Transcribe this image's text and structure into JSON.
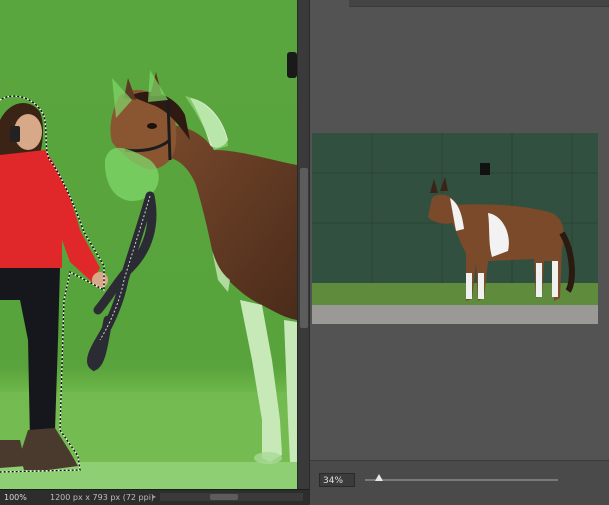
{
  "canvas": {
    "zoom_label": "100%",
    "document_info": "1200 px x 793 px (72 ppi)",
    "status_arrow_icon": "chevron-right-icon"
  },
  "preview_panel": {
    "zoom_value": "34%",
    "zoom_fraction": 0.34
  },
  "colors": {
    "green_screen": "#5aa63f",
    "panel_bg": "#535353",
    "overlay_tint": "#7fd86a"
  }
}
